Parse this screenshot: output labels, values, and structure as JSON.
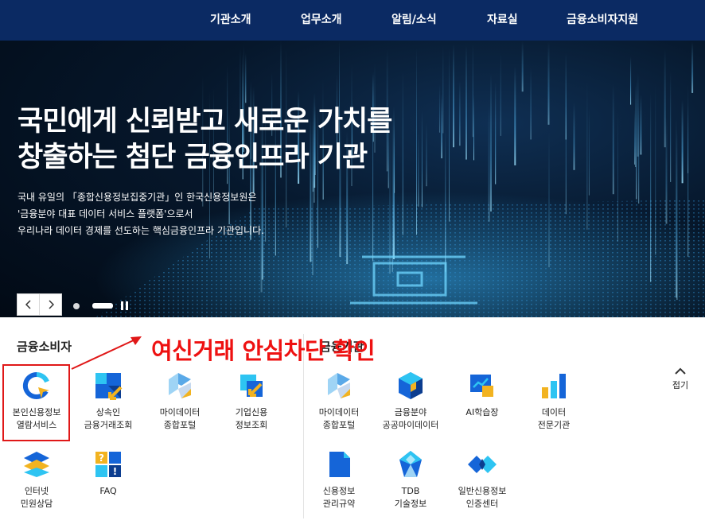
{
  "nav": {
    "items": [
      "기관소개",
      "업무소개",
      "알림/소식",
      "자료실",
      "금융소비자지원"
    ]
  },
  "hero": {
    "headline": [
      "국민에게 신뢰받고 새로운 가치를",
      "창출하는 첨단 금융인프라 기관"
    ],
    "description": [
      "국내 유일의 「종합신용정보집중기관」인 한국신용정보원은",
      "'금융분야 대표 데이터 서비스 플랫폼'으로서",
      "우리나라 데이터 경제를 선도하는 핵심금융인프라 기관입니다."
    ],
    "slider": {
      "current": 2,
      "total": 2
    }
  },
  "consumer": {
    "title": "금융소비자",
    "items": [
      {
        "label": [
          "본인신용정보",
          "열람서비스"
        ],
        "icon": "refresh-search-icon"
      },
      {
        "label": [
          "상속인",
          "금융거래조회"
        ],
        "icon": "blue-yellow-arrow-icon"
      },
      {
        "label": [
          "마이데이터",
          "종합포털"
        ],
        "icon": "diamond-tiles-icon"
      },
      {
        "label": [
          "기업신용",
          "정보조회"
        ],
        "icon": "blue-arrow-square-icon"
      },
      {
        "label": [
          "인터넷",
          "민원상담"
        ],
        "icon": "layers-icon"
      },
      {
        "label": [
          "FAQ"
        ],
        "icon": "faq-icon"
      }
    ]
  },
  "institution": {
    "title": "금융기관",
    "items": [
      {
        "label": [
          "마이데이터",
          "종합포털"
        ],
        "icon": "diamond-tiles-icon"
      },
      {
        "label": [
          "금융분야",
          "공공마이데이터"
        ],
        "icon": "hexagon-cube-icon"
      },
      {
        "label": [
          "AI학습장"
        ],
        "icon": "chart-monitor-icon"
      },
      {
        "label": [
          "데이터",
          "전문기관"
        ],
        "icon": "bar-chart-icon"
      },
      {
        "label": [
          "신용정보",
          "관리규약"
        ],
        "icon": "document-icon"
      },
      {
        "label": [
          "TDB",
          "기술정보"
        ],
        "icon": "crystal-icon"
      },
      {
        "label": [
          "일반신용정보",
          "인증센터"
        ],
        "icon": "double-diamond-icon"
      }
    ]
  },
  "fold": {
    "label": "접기"
  },
  "annotation": {
    "text": "여신거래 안심차단 확인",
    "color": "#ee1111"
  },
  "colors": {
    "nav": "#0b2a63",
    "accent": "#1565d8",
    "yellow": "#f2b320"
  }
}
